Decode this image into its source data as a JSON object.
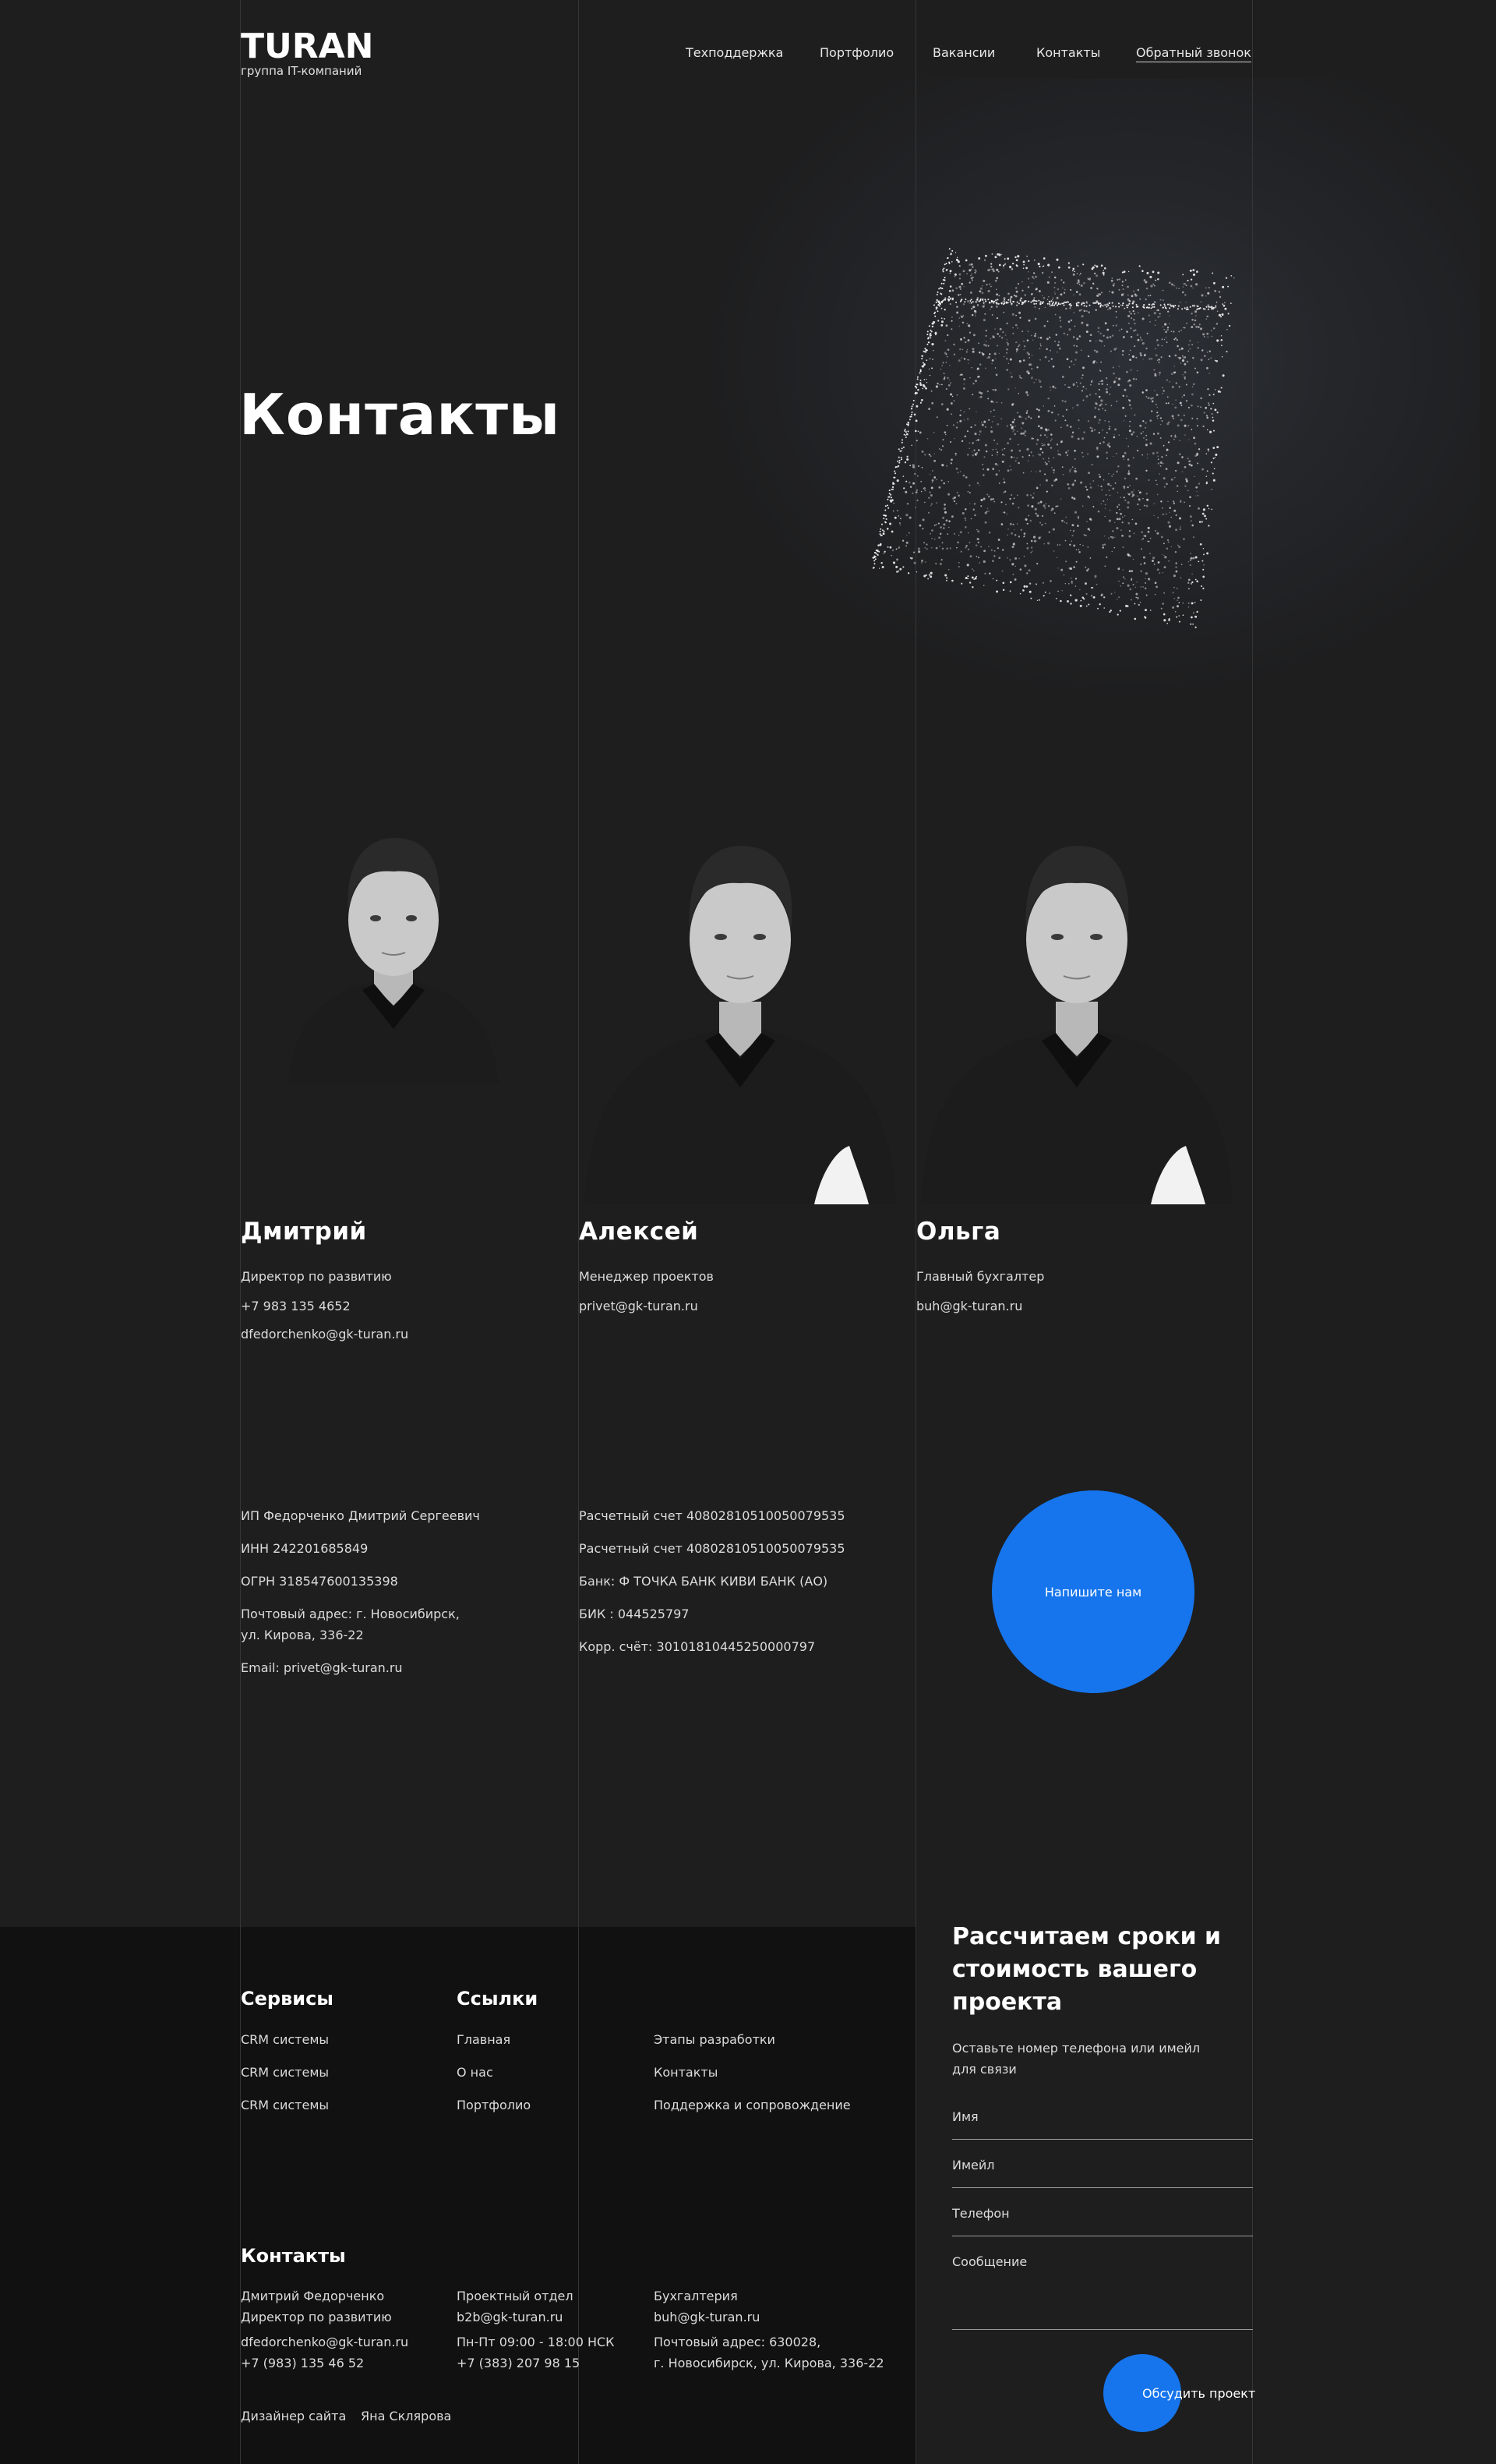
{
  "colors": {
    "background": "#1e1e1f",
    "footer": "#111112",
    "accent": "#1675ec",
    "text": "#e6e6e6"
  },
  "header": {
    "logo": "TURAN",
    "logo_sub": "группа IT-компаний",
    "nav": [
      "Техподдержка",
      "Портфолио",
      "Вакансии",
      "Контакты"
    ],
    "callback": "Обратный звонок"
  },
  "hero": {
    "title": "Контакты",
    "image_icon": "particle-cube-icon"
  },
  "people": [
    {
      "name": "Дмитрий",
      "role": "Директор по развитию",
      "phone": "+7 983 135 4652",
      "email": "dfedorchenko@gk-turan.ru"
    },
    {
      "name": "Алексей",
      "role": "Менеджер проектов",
      "email": "privet@gk-turan.ru"
    },
    {
      "name": "Ольга",
      "role": "Главный бухгалтер",
      "email": "buh@gk-turan.ru"
    }
  ],
  "company": {
    "owner": "ИП Федорченко Дмитрий Сергеевич",
    "inn": "ИНН 242201685849",
    "ogrn": "ОГРН  318547600135398",
    "address1": "Почтовый адрес: г. Новосибирск,",
    "address2": "ул. Кирова, 336-22",
    "email": "Email: privet@gk-turan.ru"
  },
  "bank": {
    "account1": "Расчетный счет 40802810510050079535",
    "account2": "Расчетный счет 40802810510050079535",
    "bank": "Банк: Ф ТОЧКА БАНК КИВИ БАНК (АО)",
    "bik": "БИК  : 044525797",
    "corr": "Корр. счёт: 30101810445250000797"
  },
  "write_us": "Напишите нам",
  "footer": {
    "services_title": "Сервисы",
    "services": [
      "CRM системы",
      "CRM системы",
      "CRM системы"
    ],
    "links_title": "Ссылки",
    "links_col1": [
      "Главная",
      "О нас",
      "Портфолио"
    ],
    "links_col2": [
      "Этапы разработки",
      "Контакты",
      "Поддержка и сопровождение"
    ],
    "contacts_title": "Контакты",
    "contact1": [
      "Дмитрий Федорченко",
      "Директор по развитию",
      "dfedorchenko@gk-turan.ru",
      "+7 (983) 135 46 52"
    ],
    "contact2": [
      "Проектный отдел",
      "b2b@gk-turan.ru",
      "Пн-Пт 09:00 - 18:00 НСК",
      "+7 (383) 207 98 15"
    ],
    "contact3": [
      "Бухгалтерия",
      "buh@gk-turan.ru",
      "Почтовый адрес: 630028,",
      "г. Новосибирск, ул. Кирова, 336-22"
    ],
    "designer_label": "Дизайнер сайта",
    "designer_name": "Яна Склярова"
  },
  "form": {
    "title": "Рассчитаем сроки и стоимость вашего проекта",
    "subtitle": "Оставьте номер телефона или имейл для связи",
    "name_placeholder": "Имя",
    "email_placeholder": "Имейл",
    "phone_placeholder": "Телефон",
    "message_placeholder": "Сообщение",
    "submit": "Обсудить проект"
  }
}
